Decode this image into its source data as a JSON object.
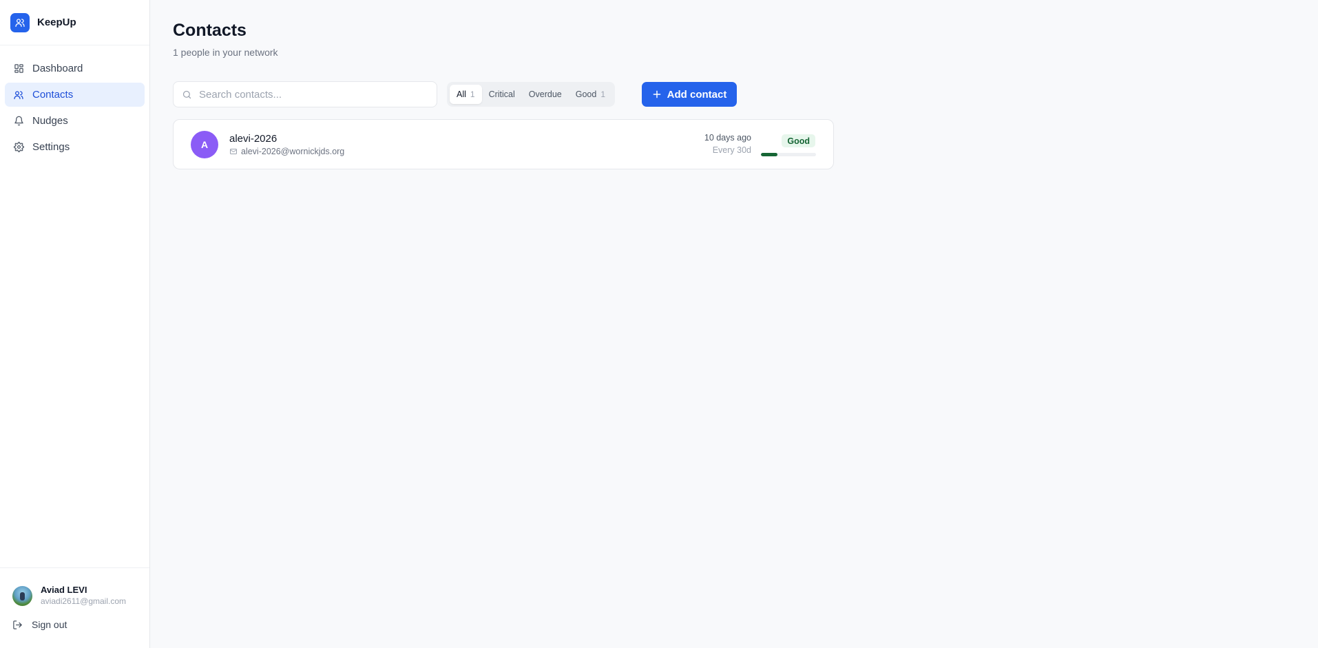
{
  "brand": {
    "name": "KeepUp",
    "icon": "users-icon",
    "color": "#2563eb"
  },
  "nav": {
    "items": [
      {
        "label": "Dashboard",
        "icon": "grid-icon",
        "active": false
      },
      {
        "label": "Contacts",
        "icon": "users-icon",
        "active": true
      },
      {
        "label": "Nudges",
        "icon": "bell-icon",
        "active": false
      },
      {
        "label": "Settings",
        "icon": "gear-icon",
        "active": false
      }
    ]
  },
  "user": {
    "name": "Aviad LEVI",
    "email": "aviadi2611@gmail.com",
    "signout_label": "Sign out"
  },
  "page": {
    "title": "Contacts",
    "subtitle": "1 people in your network"
  },
  "search": {
    "placeholder": "Search contacts...",
    "value": ""
  },
  "filters": [
    {
      "label": "All",
      "count": "1",
      "active": true
    },
    {
      "label": "Critical",
      "count": "",
      "active": false
    },
    {
      "label": "Overdue",
      "count": "",
      "active": false
    },
    {
      "label": "Good",
      "count": "1",
      "active": false
    }
  ],
  "add_button": {
    "label": "Add contact"
  },
  "contacts": [
    {
      "initial": "A",
      "name": "alevi-2026",
      "email": "alevi-2026@wornickjds.org",
      "last_contact": "10 days ago",
      "frequency": "Every 30d",
      "status": "Good",
      "progress": 0.3,
      "avatar_color": "#8b5cf6",
      "status_color": "#166534"
    }
  ]
}
